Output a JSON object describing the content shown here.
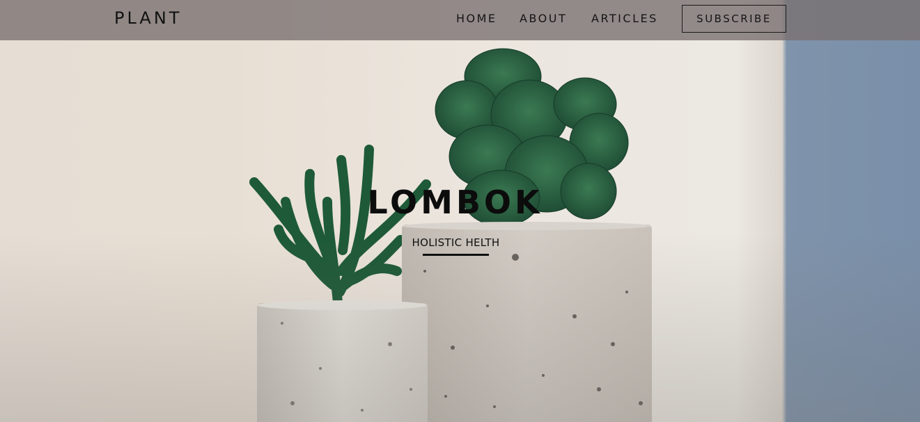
{
  "navbar": {
    "brand": "PLANT",
    "links": [
      "HOME",
      "ABOUT",
      "ARTICLES"
    ],
    "subscribe_label": "SUBSCRIBE"
  },
  "hero": {
    "title": "LOMBOK",
    "subtitle": "HOLISTIC HELTH",
    "background_image": "two-potted-cacti-photo"
  },
  "colors": {
    "navbar_bg": "#7f7676",
    "text": "#111111",
    "cactus_green": "#2f6b48",
    "pot_concrete": "#cfcac4",
    "wall_blue": "#7a8fa9"
  }
}
